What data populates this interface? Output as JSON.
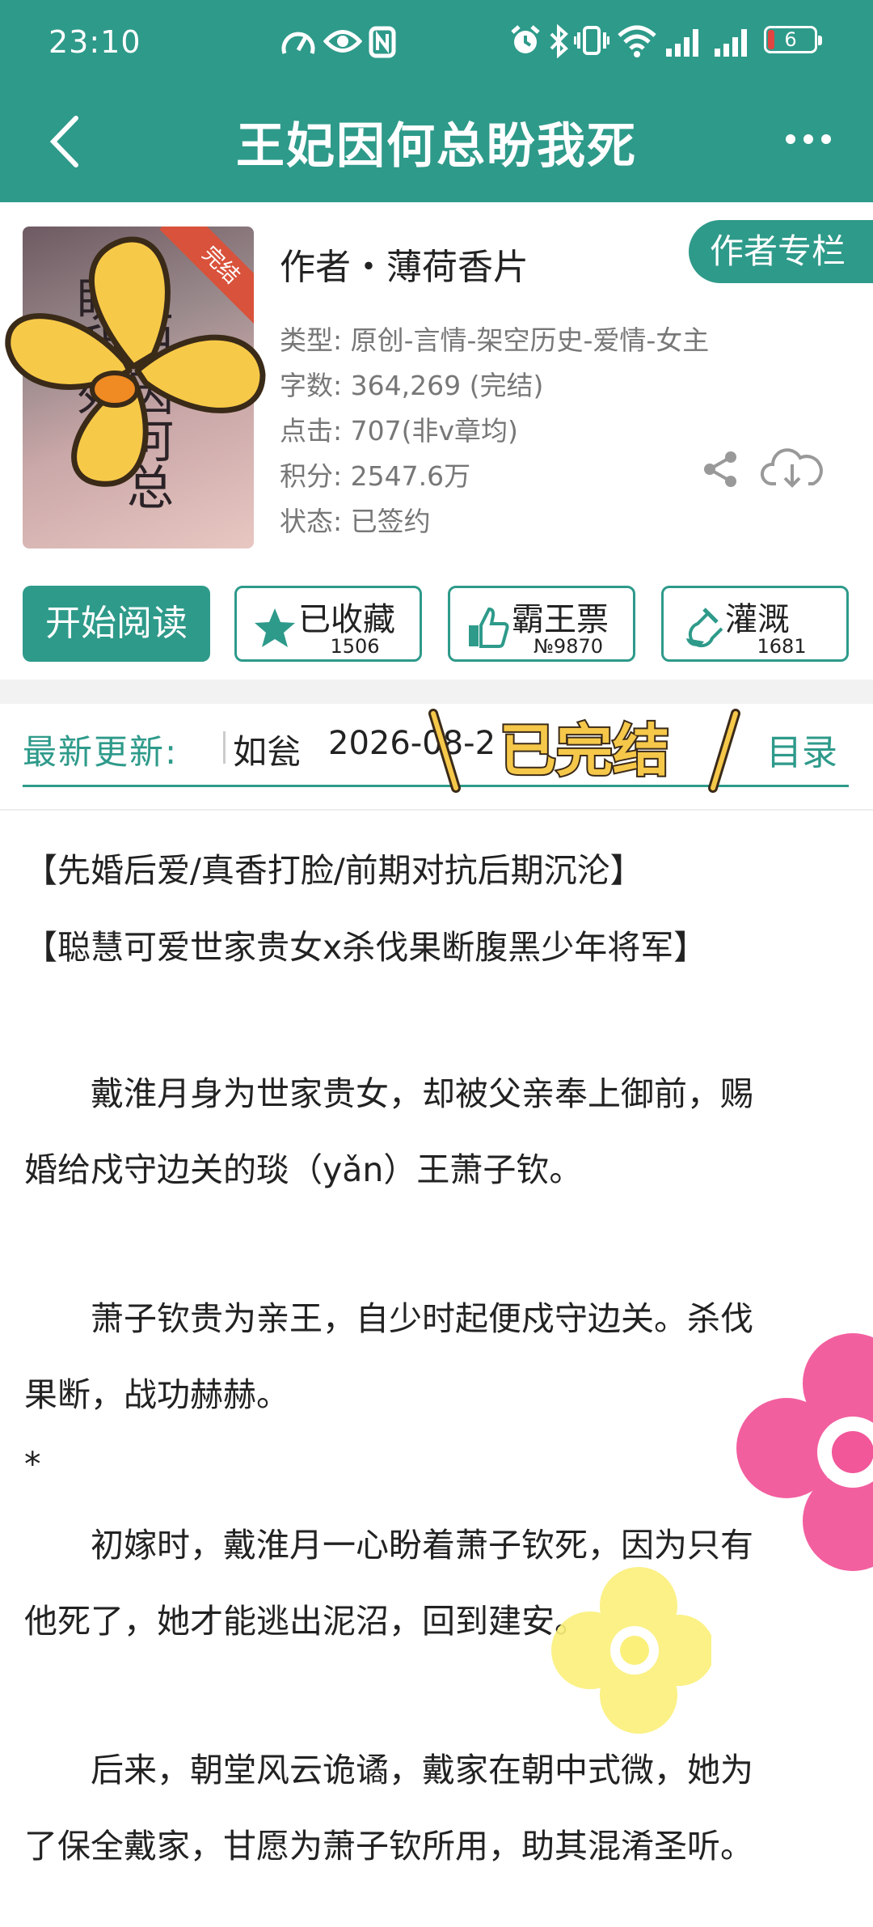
{
  "status_bar": {
    "time": "23:10",
    "battery": "6",
    "net1": "4G",
    "net2": "4G",
    "wifi_badge": "6"
  },
  "header": {
    "title": "王妃因何总盼我死"
  },
  "book": {
    "cover_badge": "完结",
    "cover_title_art": "王妃因何总盼我死",
    "author": "作者・薄荷香片",
    "author_column_button": "作者专栏",
    "meta": [
      {
        "label": "类型:",
        "value": "原创-言情-架空历史-爱情-女主"
      },
      {
        "label": "字数:",
        "value": "364,269 (完结)"
      },
      {
        "label": "点击:",
        "value": "707(非v章均)"
      },
      {
        "label": "积分:",
        "value": "2547.6万"
      },
      {
        "label": "状态:",
        "value": "已签约"
      }
    ]
  },
  "actions": {
    "start_reading": "开始阅读",
    "collect": {
      "label": "已收藏",
      "count": "1506"
    },
    "vote": {
      "label": "霸王票",
      "count": "№9870"
    },
    "nutrient": {
      "label": "灌溉",
      "count": "1681"
    }
  },
  "update": {
    "label": "最新更新:",
    "chapter": "如瓮",
    "date": "2026-08-2",
    "sticker": "已完结",
    "toc": "目录"
  },
  "synopsis": [
    "【先婚后爱/真香打脸/前期对抗后期沉沦】",
    "【聪慧可爱世家贵女x杀伐果断腹黑少年将军】",
    "　　戴淮月身为世家贵女，却被父亲奉上御前，赐",
    "婚给戍守边关的琰（yǎn）王萧子钦。",
    "　　萧子钦贵为亲王，自少时起便戍守边关。杀伐",
    "果断，战功赫赫。",
    "*",
    "　　初嫁时，戴淮月一心盼着萧子钦死，因为只有",
    "他死了，她才能逃出泥沼，回到建安。",
    "　　后来，朝堂风云诡谲，戴家在朝中式微，她为",
    "了保全戴家，甘愿为萧子钦所用，助其混淆圣听。"
  ],
  "colors": {
    "accent": "#2e9a8a",
    "sticker_yellow": "#f6c84a",
    "flower_pink": "#f2579a"
  }
}
